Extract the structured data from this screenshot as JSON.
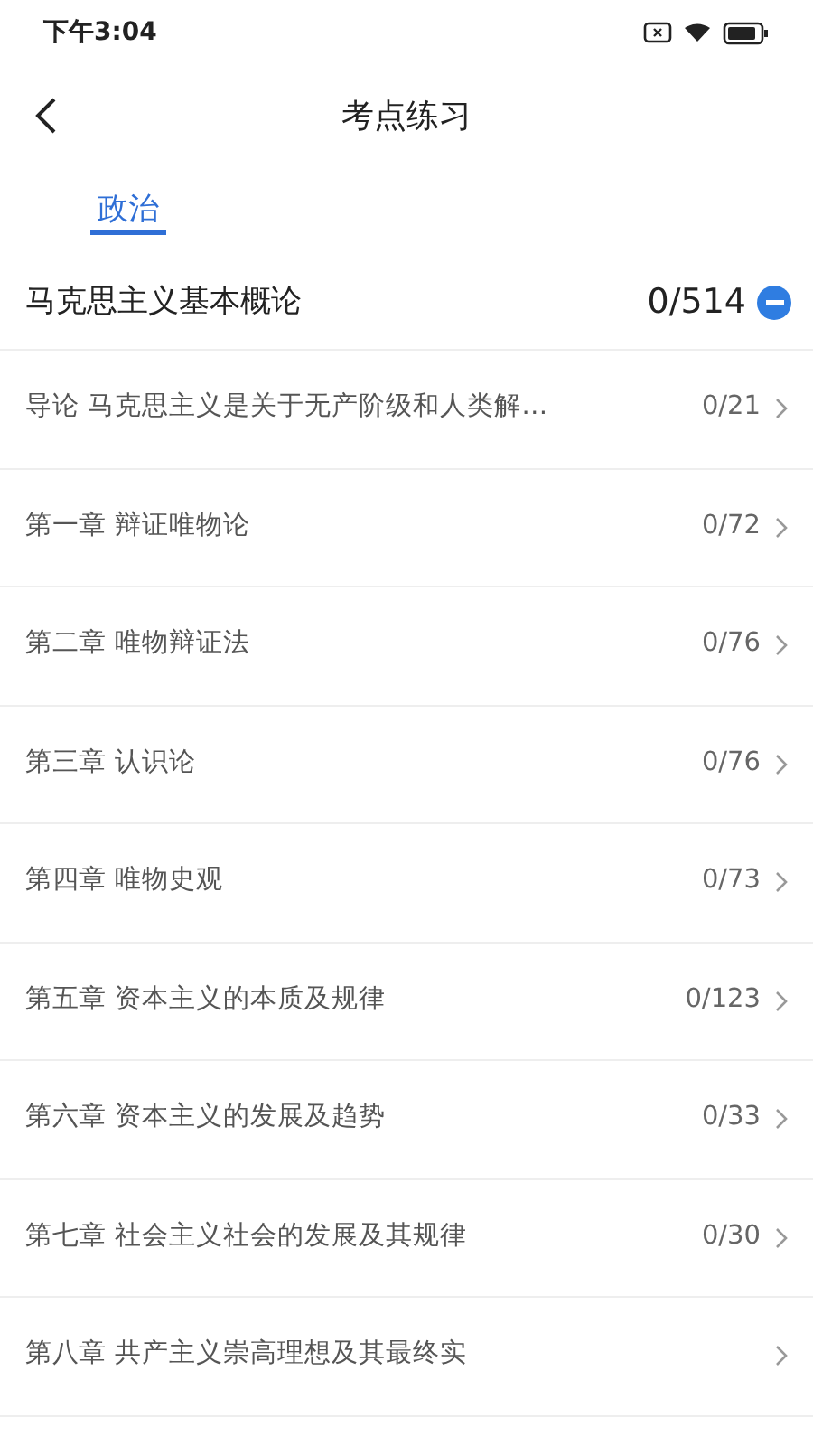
{
  "status_bar": {
    "time": "下午3:04"
  },
  "header": {
    "title": "考点练习"
  },
  "tabs": [
    {
      "label": "政治",
      "selected": true
    }
  ],
  "section": {
    "title": "马克思主义基本概论",
    "count": "0/514",
    "expanded": true
  },
  "rows": [
    {
      "title": "导论 马克思主义是关于无产阶级和人类解…",
      "count": "0/21"
    },
    {
      "title": "第一章 辩证唯物论",
      "count": "0/72"
    },
    {
      "title": "第二章 唯物辩证法",
      "count": "0/76"
    },
    {
      "title": "第三章 认识论",
      "count": "0/76"
    },
    {
      "title": "第四章 唯物史观",
      "count": "0/73"
    },
    {
      "title": "第五章 资本主义的本质及规律",
      "count": "0/123"
    },
    {
      "title": "第六章 资本主义的发展及趋势",
      "count": "0/33"
    },
    {
      "title": "第七章 社会主义社会的发展及其规律",
      "count": "0/30"
    },
    {
      "title": "第八章 共产主义崇高理想及其最终实"
    }
  ]
}
